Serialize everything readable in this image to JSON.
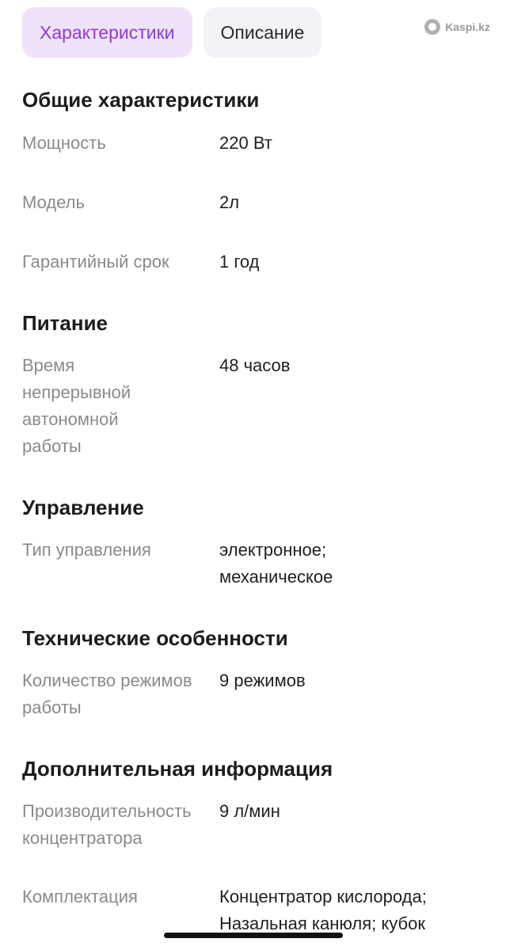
{
  "tabs": [
    {
      "label": "Характеристики",
      "active": true
    },
    {
      "label": "Описание",
      "active": false
    }
  ],
  "watermark": {
    "text": "Kaspi.kz",
    "icon": "kaspi-logo-icon"
  },
  "sections": [
    {
      "title": "Общие характеристики",
      "rows": [
        {
          "label": "Мощность",
          "value": "220 Вт"
        },
        {
          "label": "Модель",
          "value": "2л"
        },
        {
          "label": "Гарантийный срок",
          "value": "1 год"
        }
      ]
    },
    {
      "title": "Питание",
      "rows": [
        {
          "label": "Время непрерывной автономной работы",
          "value": "48 часов"
        }
      ]
    },
    {
      "title": "Управление",
      "rows": [
        {
          "label": "Тип управления",
          "value": "электронное; механическое"
        }
      ]
    },
    {
      "title": "Технические особенности",
      "rows": [
        {
          "label": "Количество режимов работы",
          "value": "9 режимов"
        }
      ]
    },
    {
      "title": "Дополнительная информация",
      "rows": [
        {
          "label": "Производительность концентратора",
          "value": "9 л/мин"
        },
        {
          "label": "Комплектация",
          "value": "Концентратор кислорода; Назальная канюля; кубок"
        }
      ]
    }
  ],
  "colors": {
    "accent": "#8d3bd6",
    "tab_active_bg": "#efe2fb",
    "label": "#8a8a8a"
  }
}
